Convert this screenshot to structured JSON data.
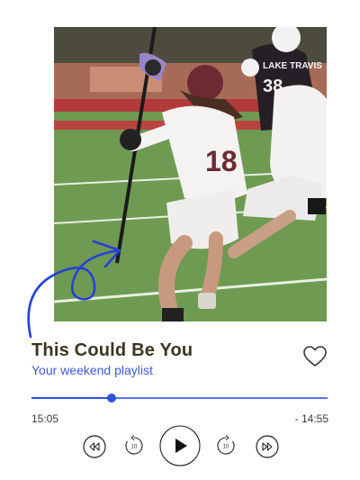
{
  "track": {
    "title": "This Could Be You",
    "subtitle": "Your weekend playlist",
    "liked": false
  },
  "photo": {
    "subject": "lacrosse-players-photo",
    "jersey_text": "LAKE TRAVIS",
    "jersey_number_front": "18",
    "jersey_number_back": "38"
  },
  "progress": {
    "elapsed": "15:05",
    "remaining": "- 14:55",
    "fraction": 0.27
  },
  "controls": {
    "rewind_icon": "rewind-icon",
    "skip_back_icon": "skip-back-10-icon",
    "skip_back_seconds": "10",
    "play_icon": "play-icon",
    "skip_forward_icon": "skip-forward-10-icon",
    "skip_forward_seconds": "10",
    "fast_forward_icon": "fast-forward-icon"
  },
  "colors": {
    "accent": "#2f52e0",
    "title": "#3b3622",
    "subtitle": "#3f5ad6"
  }
}
